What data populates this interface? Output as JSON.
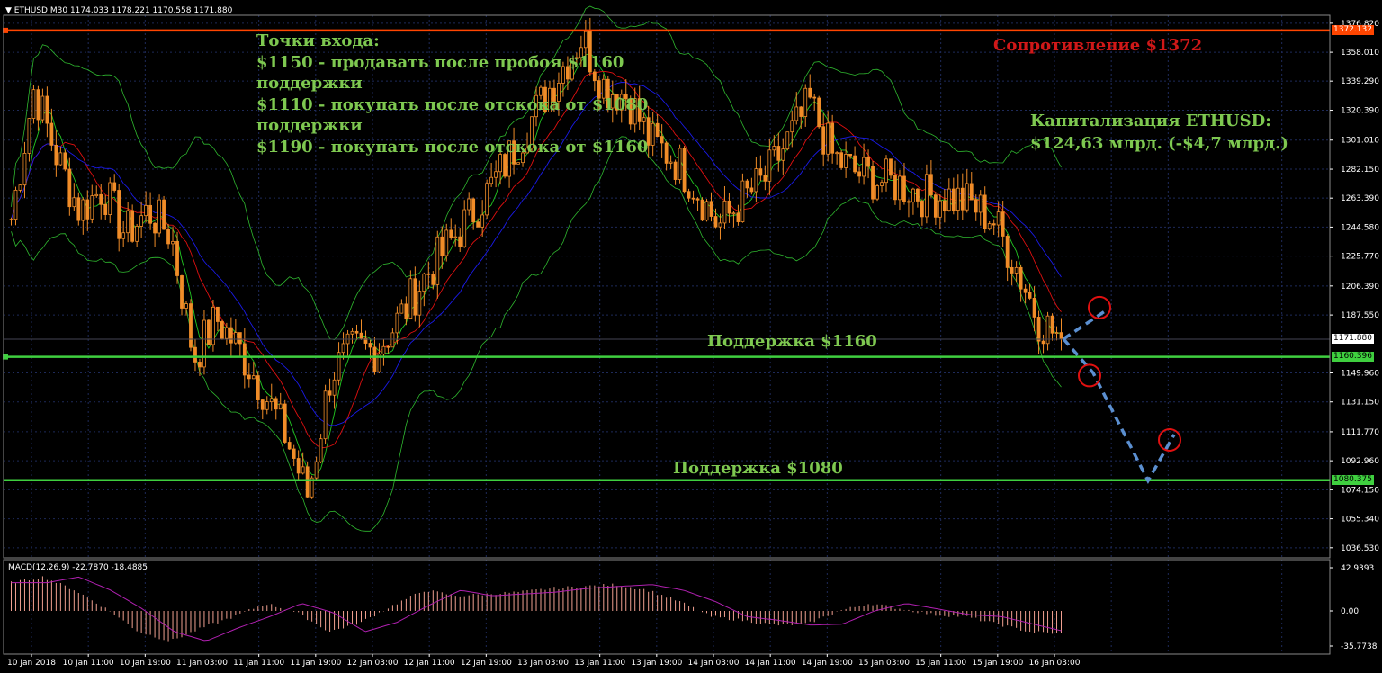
{
  "header": {
    "symbol": "ETHUSD,M30",
    "ohlc": "1174.033 1178.221 1170.558 1171.880"
  },
  "annotations": {
    "entry_lines": [
      "Точки входа:",
      "$1150 - продавать после пробоя $1160",
      "поддержки",
      "$1110 - покупать после отскока от $1080",
      "поддержки",
      "$1190 - покупать после отскока от $1160"
    ],
    "resistance": "Сопротивление $1372",
    "cap_lines": [
      "Капитализация ETHUSD:",
      "$124,63 млрд. (-$4,7 млрд.)"
    ],
    "support_1160": "Поддержка $1160",
    "support_1080": "Поддержка $1080"
  },
  "price_axis": {
    "ticks": [
      "1376.820",
      "1358.010",
      "1339.290",
      "1320.390",
      "1301.010",
      "1282.150",
      "1263.390",
      "1244.580",
      "1225.770",
      "1206.390",
      "1187.550",
      "1149.960",
      "1131.150",
      "1111.770",
      "1092.960",
      "1074.150",
      "1055.340",
      "1036.530"
    ],
    "markers": [
      {
        "label": "1372.132",
        "value": 1372.132,
        "color": "#ff4500",
        "text_color": "#ffffff"
      },
      {
        "label": "1171.880",
        "value": 1171.88,
        "color": "#ffffff",
        "text_color": "#000000"
      },
      {
        "label": "1160.396",
        "value": 1160.396,
        "color": "#3fcf3f",
        "text_color": "#000000"
      },
      {
        "label": "1080.375",
        "value": 1080.375,
        "color": "#3fcf3f",
        "text_color": "#000000"
      }
    ]
  },
  "time_axis": [
    "10 Jan 2018",
    "10 Jan 11:00",
    "10 Jan 19:00",
    "11 Jan 03:00",
    "11 Jan 11:00",
    "11 Jan 19:00",
    "12 Jan 03:00",
    "12 Jan 11:00",
    "12 Jan 19:00",
    "13 Jan 03:00",
    "13 Jan 11:00",
    "13 Jan 19:00",
    "14 Jan 03:00",
    "14 Jan 11:00",
    "14 Jan 19:00",
    "15 Jan 03:00",
    "15 Jan 11:00",
    "15 Jan 19:00",
    "16 Jan 03:00"
  ],
  "macd": {
    "header": "MACD(12,26,9) -22.7870 -18.4885",
    "ticks": [
      "42.9393",
      "0.00",
      "-35.7738"
    ]
  },
  "colors": {
    "background": "#000000",
    "candle": "#f08c28",
    "grid": "#1e2a5a",
    "resistance_line": "#ff4500",
    "support_line": "#3fcf3f",
    "ma_red": "#e01010",
    "ma_blue": "#1a1ae8",
    "ma_green": "#22c822",
    "bollinger": "#2fb82f",
    "forecast": "#5b8fd0",
    "circle": "#e01010",
    "macd_hist": "#f0a090",
    "macd_signal": "#b020b0"
  },
  "chart_data": {
    "type": "candlestick",
    "symbol": "ETHUSD,M30",
    "x": [
      "10 Jan 2018",
      "10 Jan 11:00",
      "10 Jan 19:00",
      "11 Jan 03:00",
      "11 Jan 11:00",
      "11 Jan 19:00",
      "12 Jan 03:00",
      "12 Jan 11:00",
      "12 Jan 19:00",
      "13 Jan 03:00",
      "13 Jan 11:00",
      "13 Jan 19:00",
      "14 Jan 03:00",
      "14 Jan 11:00",
      "14 Jan 19:00",
      "15 Jan 03:00",
      "15 Jan 11:00",
      "15 Jan 19:00",
      "16 Jan 03:00"
    ],
    "close_path": [
      1250,
      1335,
      1290,
      1255,
      1270,
      1240,
      1255,
      1240,
      1160,
      1185,
      1165,
      1140,
      1110,
      1070,
      1150,
      1165,
      1165,
      1185,
      1210,
      1230,
      1250,
      1270,
      1295,
      1320,
      1345,
      1368,
      1335,
      1330,
      1300,
      1290,
      1270,
      1245,
      1262,
      1275,
      1300,
      1325,
      1290,
      1280,
      1275,
      1272,
      1265,
      1265,
      1260,
      1250,
      1220,
      1185,
      1172
    ],
    "levels": {
      "resistance": 1372.132,
      "support_upper": 1160.396,
      "support_lower": 1080.375,
      "last": 1171.88
    },
    "forecast_path": [
      [
        0,
        1172
      ],
      [
        1,
        1190
      ],
      [
        0,
        1172
      ],
      [
        1,
        1150
      ],
      [
        2,
        1080
      ],
      [
        3,
        1110
      ]
    ],
    "ylim": [
      1030,
      1382
    ],
    "macd_hist_path": [
      30,
      36,
      22,
      2,
      -22,
      -32,
      -18,
      -6,
      8,
      -2,
      -22,
      -12,
      6,
      22,
      16,
      18,
      20,
      24,
      26,
      28,
      22,
      10,
      -6,
      -10,
      -15,
      -14,
      0,
      8,
      2,
      -4,
      -6,
      -14,
      -22,
      -24
    ]
  }
}
